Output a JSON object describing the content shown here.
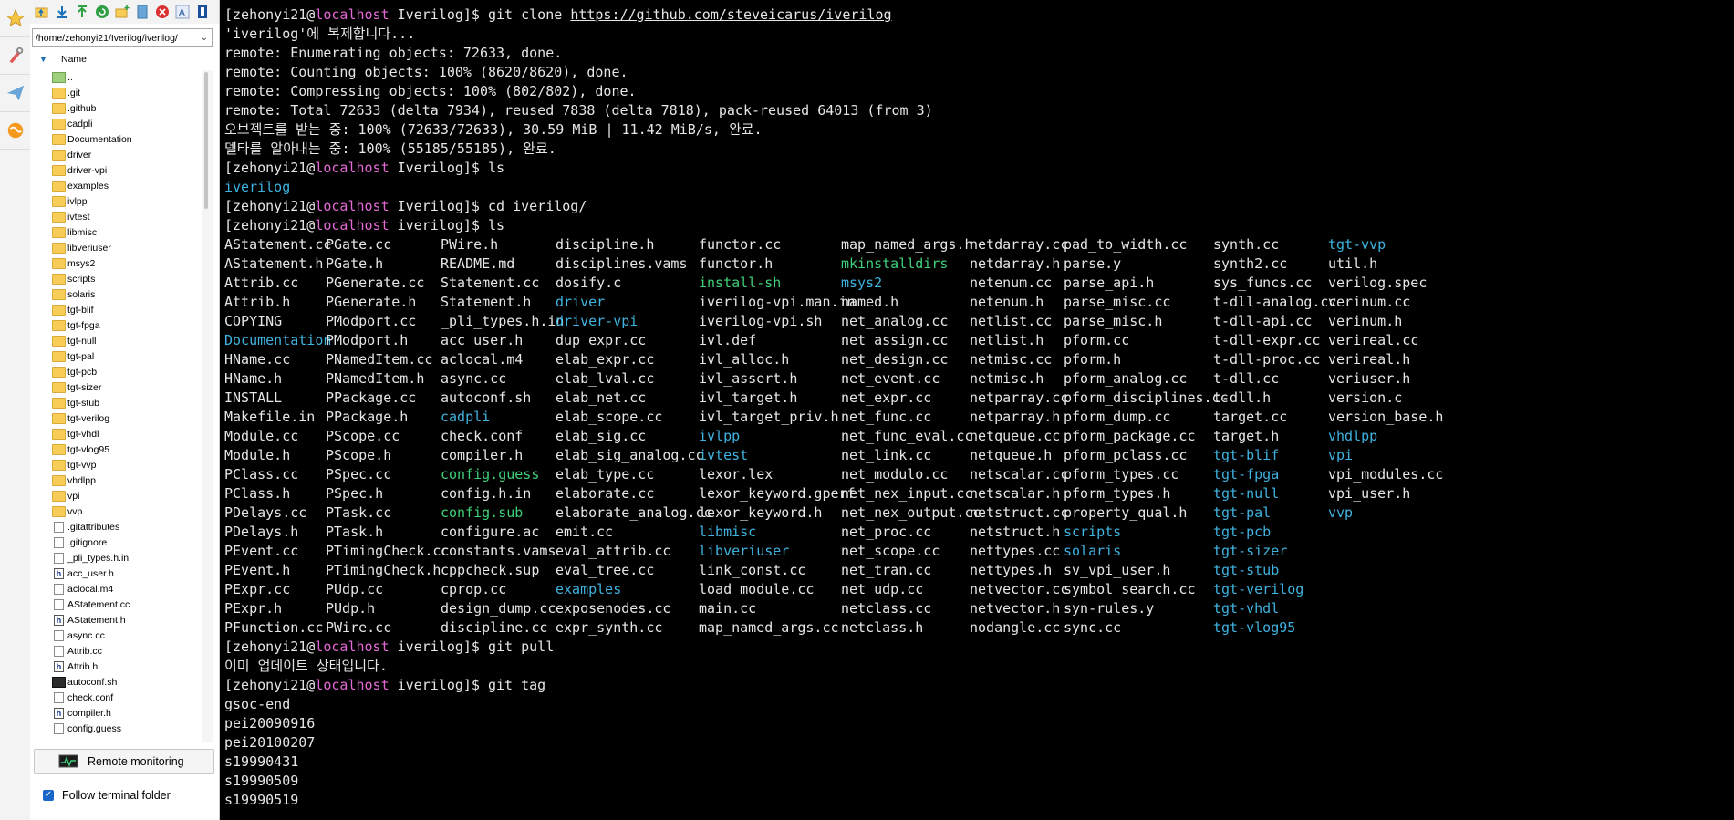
{
  "toolbar": {
    "icons": [
      "up-folder-icon",
      "download-icon",
      "upload-icon",
      "refresh-icon",
      "new-folder-icon",
      "new-file-icon",
      "delete-icon",
      "rename-icon",
      "properties-icon"
    ],
    "colors": {
      "green": "#2ea043",
      "blue": "#1b6fb8",
      "red": "#d93030"
    }
  },
  "sidebar": {
    "path": "/home/zehonyi21/Iverilog/iverilog/",
    "column_header": "Name",
    "files": [
      {
        "name": "..",
        "type": "up"
      },
      {
        "name": ".git",
        "type": "folder"
      },
      {
        "name": ".github",
        "type": "folder"
      },
      {
        "name": "cadpli",
        "type": "folder"
      },
      {
        "name": "Documentation",
        "type": "folder"
      },
      {
        "name": "driver",
        "type": "folder"
      },
      {
        "name": "driver-vpi",
        "type": "folder"
      },
      {
        "name": "examples",
        "type": "folder"
      },
      {
        "name": "ivlpp",
        "type": "folder"
      },
      {
        "name": "ivtest",
        "type": "folder"
      },
      {
        "name": "libmisc",
        "type": "folder"
      },
      {
        "name": "libveriuser",
        "type": "folder"
      },
      {
        "name": "msys2",
        "type": "folder"
      },
      {
        "name": "scripts",
        "type": "folder"
      },
      {
        "name": "solaris",
        "type": "folder"
      },
      {
        "name": "tgt-blif",
        "type": "folder"
      },
      {
        "name": "tgt-fpga",
        "type": "folder"
      },
      {
        "name": "tgt-null",
        "type": "folder"
      },
      {
        "name": "tgt-pal",
        "type": "folder"
      },
      {
        "name": "tgt-pcb",
        "type": "folder"
      },
      {
        "name": "tgt-sizer",
        "type": "folder"
      },
      {
        "name": "tgt-stub",
        "type": "folder"
      },
      {
        "name": "tgt-verilog",
        "type": "folder"
      },
      {
        "name": "tgt-vhdl",
        "type": "folder"
      },
      {
        "name": "tgt-vlog95",
        "type": "folder"
      },
      {
        "name": "tgt-vvp",
        "type": "folder"
      },
      {
        "name": "vhdlpp",
        "type": "folder"
      },
      {
        "name": "vpi",
        "type": "folder"
      },
      {
        "name": "vvp",
        "type": "folder"
      },
      {
        "name": ".gitattributes",
        "type": "file"
      },
      {
        "name": ".gitignore",
        "type": "file"
      },
      {
        "name": "_pli_types.h.in",
        "type": "file"
      },
      {
        "name": "acc_user.h",
        "type": "header"
      },
      {
        "name": "aclocal.m4",
        "type": "file"
      },
      {
        "name": "AStatement.cc",
        "type": "file"
      },
      {
        "name": "AStatement.h",
        "type": "header"
      },
      {
        "name": "async.cc",
        "type": "file"
      },
      {
        "name": "Attrib.cc",
        "type": "file"
      },
      {
        "name": "Attrib.h",
        "type": "header"
      },
      {
        "name": "autoconf.sh",
        "type": "script"
      },
      {
        "name": "check.conf",
        "type": "file"
      },
      {
        "name": "compiler.h",
        "type": "header"
      },
      {
        "name": "config.guess",
        "type": "file"
      }
    ],
    "monitor_label": "Remote monitoring",
    "follow_label": "Follow terminal folder",
    "follow_checked": true
  },
  "terminal": {
    "lines_top": [
      {
        "user": "[zehonyi21@",
        "host": "localhost",
        "rest": " Iverilog]$ git clone ",
        "url": "https://github.com/steveicarus/iverilog"
      },
      {
        "text": "'iverilog'에 복제합니다..."
      },
      {
        "text": "remote: Enumerating objects: 72633, done."
      },
      {
        "text": "remote: Counting objects: 100% (8620/8620), done."
      },
      {
        "text": "remote: Compressing objects: 100% (802/802), done."
      },
      {
        "text": "remote: Total 72633 (delta 7934), reused 7838 (delta 7818), pack-reused 64013 (from 3)"
      },
      {
        "text": "오브젝트를 받는 중: 100% (72633/72633), 30.59 MiB | 11.42 MiB/s, 완료."
      },
      {
        "text": "델타를 알아내는 중: 100% (55185/55185), 완료."
      },
      {
        "user": "[zehonyi21@",
        "host": "localhost",
        "rest": " Iverilog]$ ls"
      },
      {
        "text": "iverilog",
        "cls": "c-dir"
      },
      {
        "user": "[zehonyi21@",
        "host": "localhost",
        "rest": " Iverilog]$ cd iverilog/"
      },
      {
        "user": "[zehonyi21@",
        "host": "localhost",
        "rest": " iverilog]$ ls"
      }
    ],
    "ls_columns": [
      [
        [
          "AStatement.cc",
          ""
        ],
        [
          "AStatement.h",
          ""
        ],
        [
          "Attrib.cc",
          ""
        ],
        [
          "Attrib.h",
          ""
        ],
        [
          "COPYING",
          ""
        ],
        [
          "Documentation",
          "c-dir"
        ],
        [
          "HName.cc",
          ""
        ],
        [
          "HName.h",
          ""
        ],
        [
          "INSTALL",
          ""
        ],
        [
          "Makefile.in",
          ""
        ],
        [
          "Module.cc",
          ""
        ],
        [
          "Module.h",
          ""
        ],
        [
          "PClass.cc",
          ""
        ],
        [
          "PClass.h",
          ""
        ],
        [
          "PDelays.cc",
          ""
        ],
        [
          "PDelays.h",
          ""
        ],
        [
          "PEvent.cc",
          ""
        ],
        [
          "PEvent.h",
          ""
        ],
        [
          "PExpr.cc",
          ""
        ],
        [
          "PExpr.h",
          ""
        ],
        [
          "PFunction.cc",
          ""
        ]
      ],
      [
        [
          "PGate.cc",
          ""
        ],
        [
          "PGate.h",
          ""
        ],
        [
          "PGenerate.cc",
          ""
        ],
        [
          "PGenerate.h",
          ""
        ],
        [
          "PModport.cc",
          ""
        ],
        [
          "PModport.h",
          ""
        ],
        [
          "PNamedItem.cc",
          ""
        ],
        [
          "PNamedItem.h",
          ""
        ],
        [
          "PPackage.cc",
          ""
        ],
        [
          "PPackage.h",
          ""
        ],
        [
          "PScope.cc",
          ""
        ],
        [
          "PScope.h",
          ""
        ],
        [
          "PSpec.cc",
          ""
        ],
        [
          "PSpec.h",
          ""
        ],
        [
          "PTask.cc",
          ""
        ],
        [
          "PTask.h",
          ""
        ],
        [
          "PTimingCheck.cc",
          ""
        ],
        [
          "PTimingCheck.h",
          ""
        ],
        [
          "PUdp.cc",
          ""
        ],
        [
          "PUdp.h",
          ""
        ],
        [
          "PWire.cc",
          ""
        ]
      ],
      [
        [
          "PWire.h",
          ""
        ],
        [
          "README.md",
          ""
        ],
        [
          "Statement.cc",
          ""
        ],
        [
          "Statement.h",
          ""
        ],
        [
          "_pli_types.h.in",
          ""
        ],
        [
          "acc_user.h",
          ""
        ],
        [
          "aclocal.m4",
          ""
        ],
        [
          "async.cc",
          ""
        ],
        [
          "autoconf.sh",
          ""
        ],
        [
          "cadpli",
          "c-dir"
        ],
        [
          "check.conf",
          ""
        ],
        [
          "compiler.h",
          ""
        ],
        [
          "config.guess",
          "c-exe"
        ],
        [
          "config.h.in",
          ""
        ],
        [
          "config.sub",
          "c-exe"
        ],
        [
          "configure.ac",
          ""
        ],
        [
          "constants.vams",
          ""
        ],
        [
          "cppcheck.sup",
          ""
        ],
        [
          "cprop.cc",
          ""
        ],
        [
          "design_dump.cc",
          ""
        ],
        [
          "discipline.cc",
          ""
        ]
      ],
      [
        [
          "discipline.h",
          ""
        ],
        [
          "disciplines.vams",
          ""
        ],
        [
          "dosify.c",
          ""
        ],
        [
          "driver",
          "c-dir"
        ],
        [
          "driver-vpi",
          "c-dir"
        ],
        [
          "dup_expr.cc",
          ""
        ],
        [
          "elab_expr.cc",
          ""
        ],
        [
          "elab_lval.cc",
          ""
        ],
        [
          "elab_net.cc",
          ""
        ],
        [
          "elab_scope.cc",
          ""
        ],
        [
          "elab_sig.cc",
          ""
        ],
        [
          "elab_sig_analog.cc",
          ""
        ],
        [
          "elab_type.cc",
          ""
        ],
        [
          "elaborate.cc",
          ""
        ],
        [
          "elaborate_analog.cc",
          ""
        ],
        [
          "emit.cc",
          ""
        ],
        [
          "eval_attrib.cc",
          ""
        ],
        [
          "eval_tree.cc",
          ""
        ],
        [
          "examples",
          "c-dir"
        ],
        [
          "exposenodes.cc",
          ""
        ],
        [
          "expr_synth.cc",
          ""
        ]
      ],
      [
        [
          "functor.cc",
          ""
        ],
        [
          "functor.h",
          ""
        ],
        [
          "install-sh",
          "c-exe"
        ],
        [
          "iverilog-vpi.man.in",
          ""
        ],
        [
          "iverilog-vpi.sh",
          ""
        ],
        [
          "ivl.def",
          ""
        ],
        [
          "ivl_alloc.h",
          ""
        ],
        [
          "ivl_assert.h",
          ""
        ],
        [
          "ivl_target.h",
          ""
        ],
        [
          "ivl_target_priv.h",
          ""
        ],
        [
          "ivlpp",
          "c-dir"
        ],
        [
          "ivtest",
          "c-dir"
        ],
        [
          "lexor.lex",
          ""
        ],
        [
          "lexor_keyword.gperf",
          ""
        ],
        [
          "lexor_keyword.h",
          ""
        ],
        [
          "libmisc",
          "c-dir"
        ],
        [
          "libveriuser",
          "c-dir"
        ],
        [
          "link_const.cc",
          ""
        ],
        [
          "load_module.cc",
          ""
        ],
        [
          "main.cc",
          ""
        ],
        [
          "map_named_args.cc",
          ""
        ]
      ],
      [
        [
          "map_named_args.h",
          ""
        ],
        [
          "mkinstalldirs",
          "c-exe"
        ],
        [
          "msys2",
          "c-dir"
        ],
        [
          "named.h",
          ""
        ],
        [
          "net_analog.cc",
          ""
        ],
        [
          "net_assign.cc",
          ""
        ],
        [
          "net_design.cc",
          ""
        ],
        [
          "net_event.cc",
          ""
        ],
        [
          "net_expr.cc",
          ""
        ],
        [
          "net_func.cc",
          ""
        ],
        [
          "net_func_eval.cc",
          ""
        ],
        [
          "net_link.cc",
          ""
        ],
        [
          "net_modulo.cc",
          ""
        ],
        [
          "net_nex_input.cc",
          ""
        ],
        [
          "net_nex_output.cc",
          ""
        ],
        [
          "net_proc.cc",
          ""
        ],
        [
          "net_scope.cc",
          ""
        ],
        [
          "net_tran.cc",
          ""
        ],
        [
          "net_udp.cc",
          ""
        ],
        [
          "netclass.cc",
          ""
        ],
        [
          "netclass.h",
          ""
        ]
      ],
      [
        [
          "netdarray.cc",
          ""
        ],
        [
          "netdarray.h",
          ""
        ],
        [
          "netenum.cc",
          ""
        ],
        [
          "netenum.h",
          ""
        ],
        [
          "netlist.cc",
          ""
        ],
        [
          "netlist.h",
          ""
        ],
        [
          "netmisc.cc",
          ""
        ],
        [
          "netmisc.h",
          ""
        ],
        [
          "netparray.cc",
          ""
        ],
        [
          "netparray.h",
          ""
        ],
        [
          "netqueue.cc",
          ""
        ],
        [
          "netqueue.h",
          ""
        ],
        [
          "netscalar.cc",
          ""
        ],
        [
          "netscalar.h",
          ""
        ],
        [
          "netstruct.cc",
          ""
        ],
        [
          "netstruct.h",
          ""
        ],
        [
          "nettypes.cc",
          ""
        ],
        [
          "nettypes.h",
          ""
        ],
        [
          "netvector.cc",
          ""
        ],
        [
          "netvector.h",
          ""
        ],
        [
          "nodangle.cc",
          ""
        ]
      ],
      [
        [
          "pad_to_width.cc",
          ""
        ],
        [
          "parse.y",
          ""
        ],
        [
          "parse_api.h",
          ""
        ],
        [
          "parse_misc.cc",
          ""
        ],
        [
          "parse_misc.h",
          ""
        ],
        [
          "pform.cc",
          ""
        ],
        [
          "pform.h",
          ""
        ],
        [
          "pform_analog.cc",
          ""
        ],
        [
          "pform_disciplines.cc",
          ""
        ],
        [
          "pform_dump.cc",
          ""
        ],
        [
          "pform_package.cc",
          ""
        ],
        [
          "pform_pclass.cc",
          ""
        ],
        [
          "pform_types.cc",
          ""
        ],
        [
          "pform_types.h",
          ""
        ],
        [
          "property_qual.h",
          ""
        ],
        [
          "scripts",
          "c-dir"
        ],
        [
          "solaris",
          "c-dir"
        ],
        [
          "sv_vpi_user.h",
          ""
        ],
        [
          "symbol_search.cc",
          ""
        ],
        [
          "syn-rules.y",
          ""
        ],
        [
          "sync.cc",
          ""
        ]
      ],
      [
        [
          "synth.cc",
          ""
        ],
        [
          "synth2.cc",
          ""
        ],
        [
          "sys_funcs.cc",
          ""
        ],
        [
          "t-dll-analog.cc",
          ""
        ],
        [
          "t-dll-api.cc",
          ""
        ],
        [
          "t-dll-expr.cc",
          ""
        ],
        [
          "t-dll-proc.cc",
          ""
        ],
        [
          "t-dll.cc",
          ""
        ],
        [
          "t-dll.h",
          ""
        ],
        [
          "target.cc",
          ""
        ],
        [
          "target.h",
          ""
        ],
        [
          "tgt-blif",
          "c-dir"
        ],
        [
          "tgt-fpga",
          "c-dir"
        ],
        [
          "tgt-null",
          "c-dir"
        ],
        [
          "tgt-pal",
          "c-dir"
        ],
        [
          "tgt-pcb",
          "c-dir"
        ],
        [
          "tgt-sizer",
          "c-dir"
        ],
        [
          "tgt-stub",
          "c-dir"
        ],
        [
          "tgt-verilog",
          "c-dir"
        ],
        [
          "tgt-vhdl",
          "c-dir"
        ],
        [
          "tgt-vlog95",
          "c-dir"
        ]
      ],
      [
        [
          "tgt-vvp",
          "c-dir"
        ],
        [
          "util.h",
          ""
        ],
        [
          "verilog.spec",
          ""
        ],
        [
          "verinum.cc",
          ""
        ],
        [
          "verinum.h",
          ""
        ],
        [
          "verireal.cc",
          ""
        ],
        [
          "verireal.h",
          ""
        ],
        [
          "veriuser.h",
          ""
        ],
        [
          "version.c",
          ""
        ],
        [
          "version_base.h",
          ""
        ],
        [
          "vhdlpp",
          "c-dir"
        ],
        [
          "vpi",
          "c-dir"
        ],
        [
          "vpi_modules.cc",
          ""
        ],
        [
          "vpi_user.h",
          ""
        ],
        [
          "vvp",
          "c-dir"
        ]
      ]
    ],
    "lines_bottom": [
      {
        "user": "[zehonyi21@",
        "host": "localhost",
        "rest": " iverilog]$ git pull"
      },
      {
        "text": "이미 업데이트 상태입니다."
      },
      {
        "user": "[zehonyi21@",
        "host": "localhost",
        "rest": " iverilog]$ git tag"
      },
      {
        "text": "gsoc-end"
      },
      {
        "text": "pei20090916"
      },
      {
        "text": "pei20100207"
      },
      {
        "text": "s19990431"
      },
      {
        "text": "s19990509"
      },
      {
        "text": "s19990519"
      }
    ],
    "colors": {
      "background": "#000000",
      "text": "#e6e6e6",
      "host": "#e26ad3",
      "directory": "#3fb3e0",
      "executable": "#3fd07a"
    }
  }
}
